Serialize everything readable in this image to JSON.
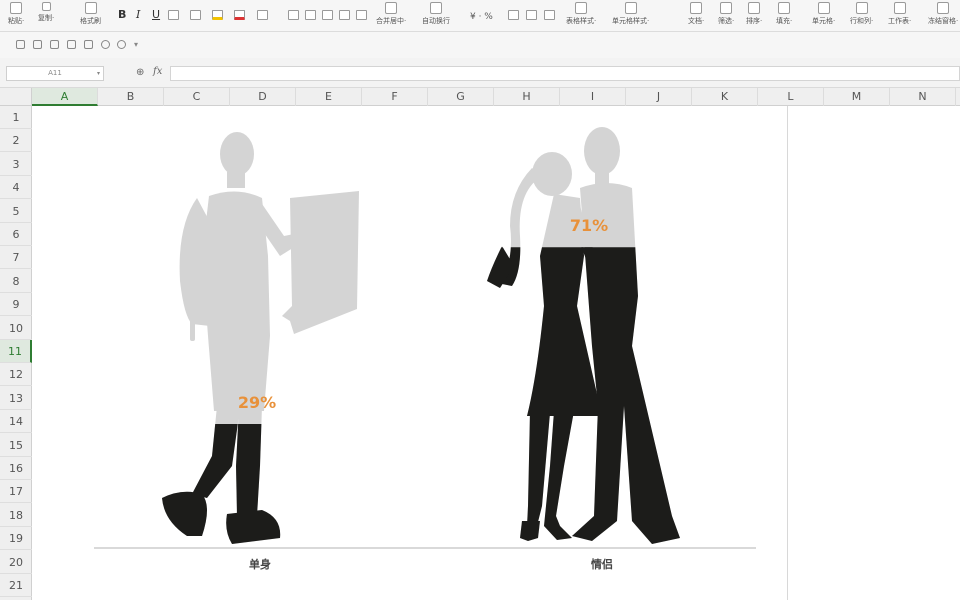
{
  "ribbon": {
    "paste": "粘贴·",
    "cut": "剪切",
    "copy": "复制·",
    "format_painter": "格式刷",
    "bold": "B",
    "italic": "I",
    "underline": "U",
    "merge_center": "合并居中·",
    "auto_wrap": "自动换行",
    "currency": "¥ · %",
    "table_style": "表格样式·",
    "cell_style": "单元格样式·",
    "text": "文档·",
    "filter": "筛选·",
    "sort": "排序·",
    "fill": "填充·",
    "cells": "单元格·",
    "rows_cols": "行和列·",
    "worksheet": "工作表·",
    "freeze": "冻结窗格·"
  },
  "formula_bar": {
    "name_box": "A11",
    "fx": "fx",
    "formula": ""
  },
  "grid": {
    "columns": [
      "A",
      "B",
      "C",
      "D",
      "E",
      "F",
      "G",
      "H",
      "I",
      "J",
      "K",
      "L",
      "M",
      "N"
    ],
    "rows": [
      "1",
      "2",
      "3",
      "4",
      "5",
      "6",
      "7",
      "8",
      "9",
      "10",
      "11",
      "12",
      "13",
      "14",
      "15",
      "16",
      "17",
      "18",
      "19",
      "20",
      "21"
    ],
    "selected_column": "A",
    "selected_row": "11"
  },
  "chart_data": {
    "type": "bar",
    "categories": [
      "单身",
      "情侣"
    ],
    "values": [
      29,
      71
    ],
    "value_labels": [
      "29%",
      "71%"
    ],
    "ylim": [
      0,
      100
    ],
    "unit": "%",
    "fill_color": "#1c1c1a",
    "empty_color": "#d4d4d4",
    "label_color": "#e8913a",
    "axis_color": "#d9d9d9"
  }
}
